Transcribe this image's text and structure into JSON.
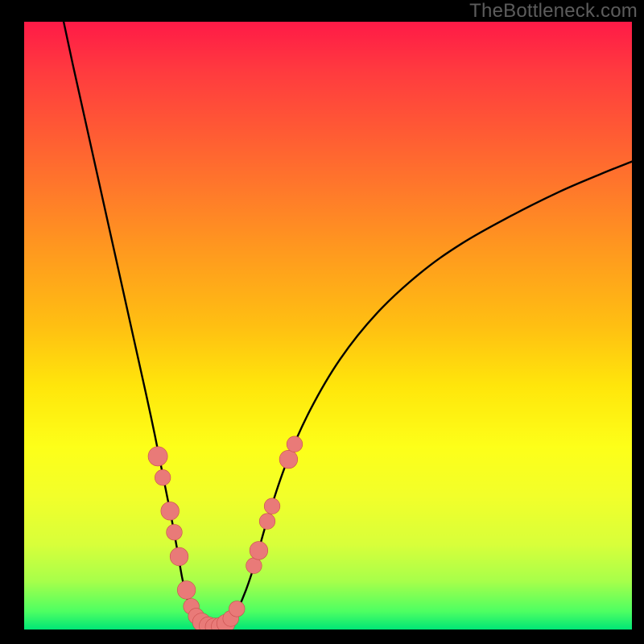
{
  "watermark": "TheBottleneck.com",
  "colors": {
    "curve": "#000000",
    "dot_fill": "#e97a78",
    "dot_stroke": "#c94d4b",
    "frame": "#000000"
  },
  "chart_data": {
    "type": "line",
    "title": "",
    "xlabel": "",
    "ylabel": "",
    "xlim": [
      0,
      100
    ],
    "ylim": [
      0,
      100
    ],
    "series": [
      {
        "name": "left-branch",
        "x": [
          6.5,
          8,
          10,
          12,
          14,
          16,
          18,
          20,
          21.5,
          23,
          24.3,
          25.3,
          26,
          26.7,
          27.5,
          28.3,
          29.2
        ],
        "y": [
          100,
          93,
          84,
          75,
          66,
          57,
          48,
          39,
          32,
          24.5,
          18,
          12.5,
          8.5,
          5.5,
          3.2,
          1.6,
          0.7
        ]
      },
      {
        "name": "valley",
        "x": [
          29.2,
          30,
          31,
          32,
          33,
          34
        ],
        "y": [
          0.7,
          0.3,
          0.2,
          0.2,
          0.5,
          1.3
        ]
      },
      {
        "name": "right-branch",
        "x": [
          34,
          35,
          36.5,
          38,
          40,
          43,
          47,
          52,
          58,
          65,
          72,
          80,
          88,
          95,
          100
        ],
        "y": [
          1.3,
          3,
          6.5,
          11,
          18,
          27,
          36,
          44.5,
          52,
          58.5,
          63.5,
          68,
          72,
          75,
          77
        ]
      }
    ],
    "dots": [
      {
        "x": 22.0,
        "y": 28.5,
        "r": 1.6
      },
      {
        "x": 22.8,
        "y": 25.0,
        "r": 1.3
      },
      {
        "x": 24.0,
        "y": 19.5,
        "r": 1.5
      },
      {
        "x": 24.7,
        "y": 16.0,
        "r": 1.3
      },
      {
        "x": 25.5,
        "y": 12.0,
        "r": 1.5
      },
      {
        "x": 26.7,
        "y": 6.5,
        "r": 1.5
      },
      {
        "x": 27.5,
        "y": 3.8,
        "r": 1.3
      },
      {
        "x": 28.3,
        "y": 2.2,
        "r": 1.3
      },
      {
        "x": 29.2,
        "y": 1.2,
        "r": 1.5
      },
      {
        "x": 30.3,
        "y": 0.6,
        "r": 1.5
      },
      {
        "x": 31.3,
        "y": 0.4,
        "r": 1.5
      },
      {
        "x": 32.3,
        "y": 0.5,
        "r": 1.5
      },
      {
        "x": 33.2,
        "y": 1.0,
        "r": 1.5
      },
      {
        "x": 34.0,
        "y": 1.8,
        "r": 1.3
      },
      {
        "x": 35.0,
        "y": 3.4,
        "r": 1.3
      },
      {
        "x": 37.8,
        "y": 10.5,
        "r": 1.3
      },
      {
        "x": 38.6,
        "y": 13.0,
        "r": 1.5
      },
      {
        "x": 40.0,
        "y": 17.8,
        "r": 1.3
      },
      {
        "x": 40.8,
        "y": 20.3,
        "r": 1.3
      },
      {
        "x": 43.5,
        "y": 28.0,
        "r": 1.5
      },
      {
        "x": 44.5,
        "y": 30.5,
        "r": 1.3
      }
    ]
  }
}
